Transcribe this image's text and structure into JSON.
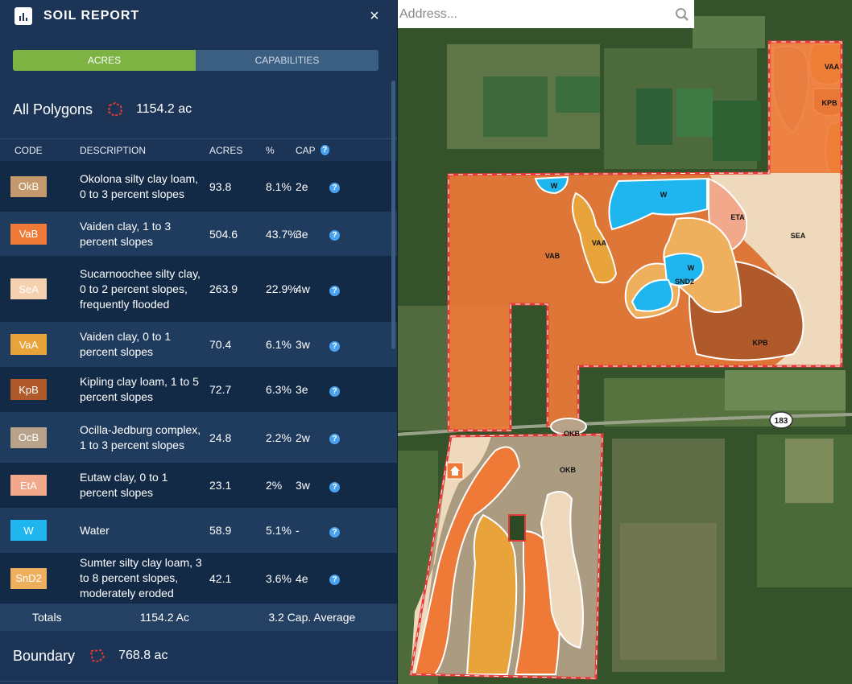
{
  "header": {
    "title": "SOIL REPORT",
    "close_glyph": "×"
  },
  "tabs": [
    {
      "label": "ACRES",
      "active": true
    },
    {
      "label": "CAPABILITIES",
      "active": false
    }
  ],
  "sections": [
    {
      "name": "All Polygons",
      "area": "1154.2 ac"
    },
    {
      "name": "Boundary",
      "area": "768.8 ac"
    }
  ],
  "columns": {
    "code": "CODE",
    "description": "DESCRIPTION",
    "acres": "ACRES",
    "pct": "%",
    "cap": "CAP"
  },
  "rows": [
    {
      "code": "OkB",
      "color": "#c49a6c",
      "description": "Okolona silty clay loam, 0 to 3 percent slopes",
      "acres": "93.8",
      "pct": "8.1%",
      "cap": "2e"
    },
    {
      "code": "VaB",
      "color": "#ef7a37",
      "description": "Vaiden clay, 1 to 3 percent slopes",
      "acres": "504.6",
      "pct": "43.7%",
      "cap": "3e"
    },
    {
      "code": "SeA",
      "color": "#f6d1b0",
      "description": "Sucarnoochee silty clay, 0 to 2 percent slopes, frequently flooded",
      "acres": "263.9",
      "pct": "22.9%",
      "cap": "4w"
    },
    {
      "code": "VaA",
      "color": "#e8a33b",
      "description": "Vaiden clay, 0 to 1 percent slopes",
      "acres": "70.4",
      "pct": "6.1%",
      "cap": "3w"
    },
    {
      "code": "KpB",
      "color": "#b0592b",
      "description": "Kipling clay loam, 1 to 5 percent slopes",
      "acres": "72.7",
      "pct": "6.3%",
      "cap": "3e"
    },
    {
      "code": "OcB",
      "color": "#b8a38a",
      "description": "Ocilla-Jedburg complex, 1 to 3 percent slopes",
      "acres": "24.8",
      "pct": "2.2%",
      "cap": "2w"
    },
    {
      "code": "EtA",
      "color": "#f2a98b",
      "description": "Eutaw clay, 0 to 1 percent slopes",
      "acres": "23.1",
      "pct": "2%",
      "cap": "3w"
    },
    {
      "code": "W",
      "color": "#1fb6ef",
      "description": "Water",
      "acres": "58.9",
      "pct": "5.1%",
      "cap": "-"
    },
    {
      "code": "SnD2",
      "color": "#eeb05d",
      "description": "Sumter silty clay loam, 3 to 8 percent slopes, moderately eroded",
      "acres": "42.1",
      "pct": "3.6%",
      "cap": "4e"
    }
  ],
  "totals": {
    "label": "Totals",
    "acres": "1154.2 Ac",
    "cap_avg": "3.2 Cap. Average"
  },
  "map": {
    "search_placeholder": "Address...",
    "road_label": "183",
    "labels": [
      "VAA",
      "KPB",
      "W",
      "W",
      "ETA",
      "SEA",
      "VAB",
      "VAA",
      "W",
      "SND2",
      "KPB",
      "OKB",
      "OKB"
    ]
  }
}
